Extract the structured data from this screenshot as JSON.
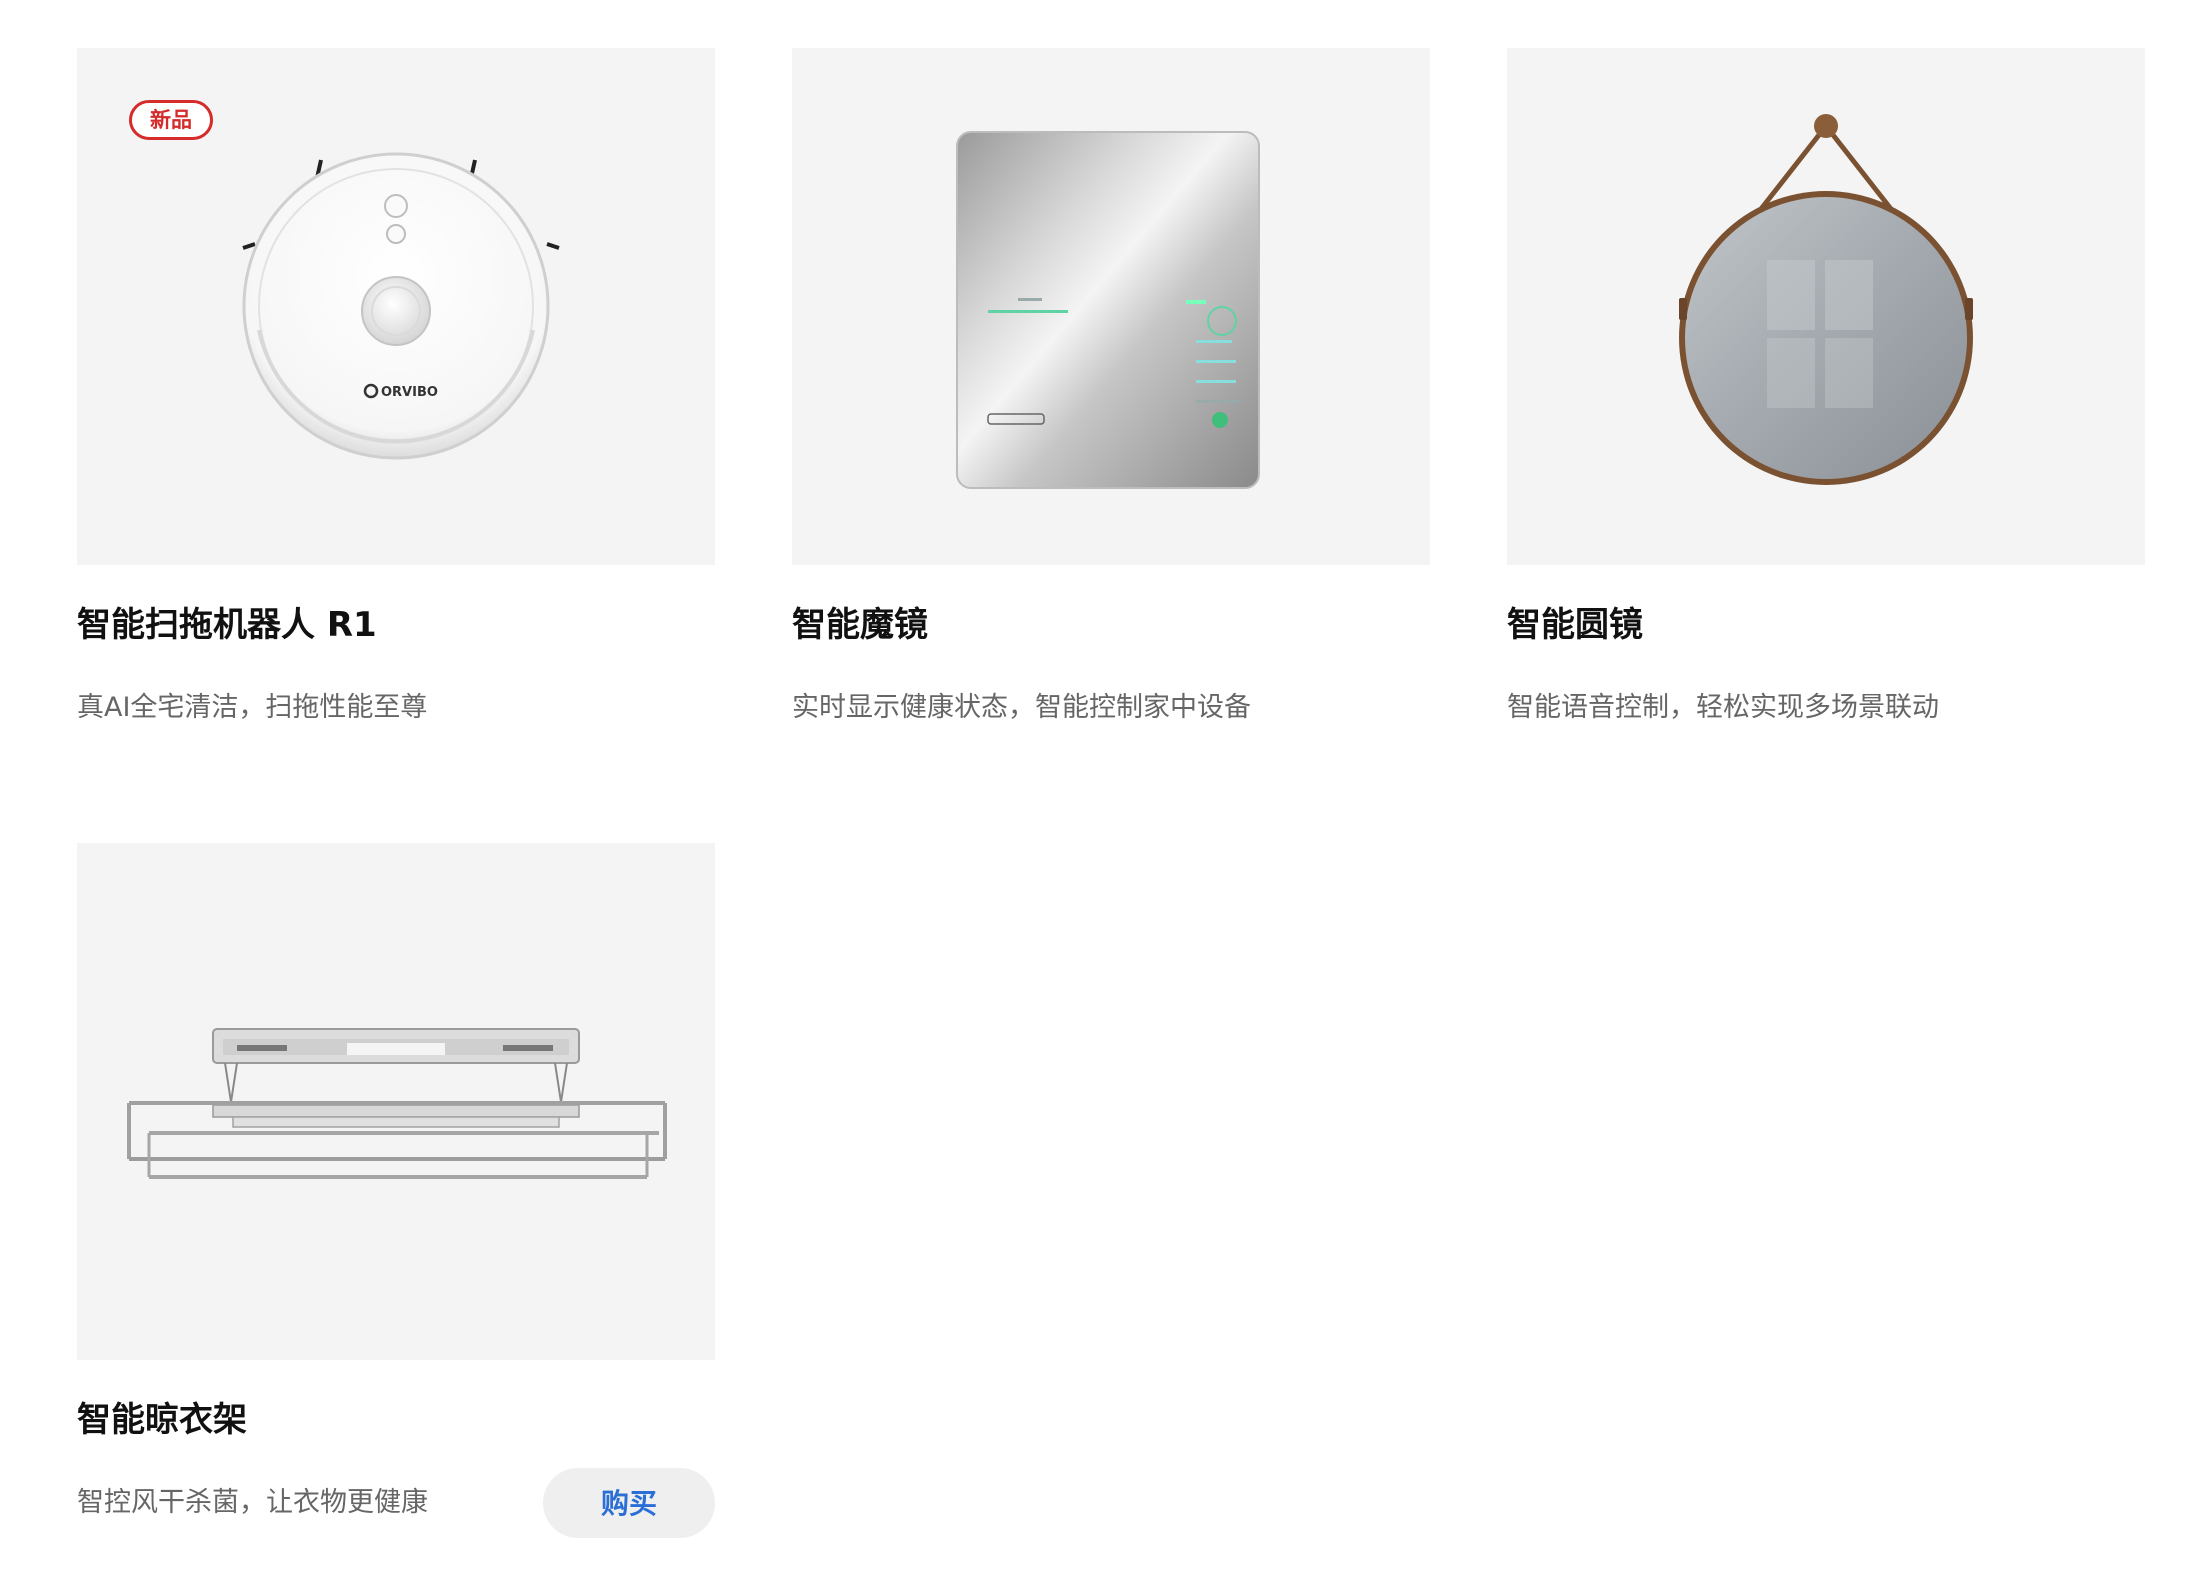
{
  "products": [
    {
      "badge": "新品",
      "title": "智能扫拖机器人 R1",
      "desc": "真AI全宅清洁，扫拖性能至尊",
      "image_icon": "robot-vacuum",
      "brand_text": "ORVIBO"
    },
    {
      "title": "智能魔镜",
      "desc": "实时显示健康状态，智能控制家中设备",
      "image_icon": "smart-mirror"
    },
    {
      "title": "智能圆镜",
      "desc": "智能语音控制，轻松实现多场景联动",
      "image_icon": "round-mirror"
    },
    {
      "title": "智能晾衣架",
      "desc": "智控风干杀菌，让衣物更健康",
      "image_icon": "drying-rack",
      "buy_label": "购买"
    }
  ],
  "colors": {
    "badge_red": "#d42b2b",
    "buy_blue": "#2b6fd6",
    "thumb_bg": "#f4f4f4"
  }
}
